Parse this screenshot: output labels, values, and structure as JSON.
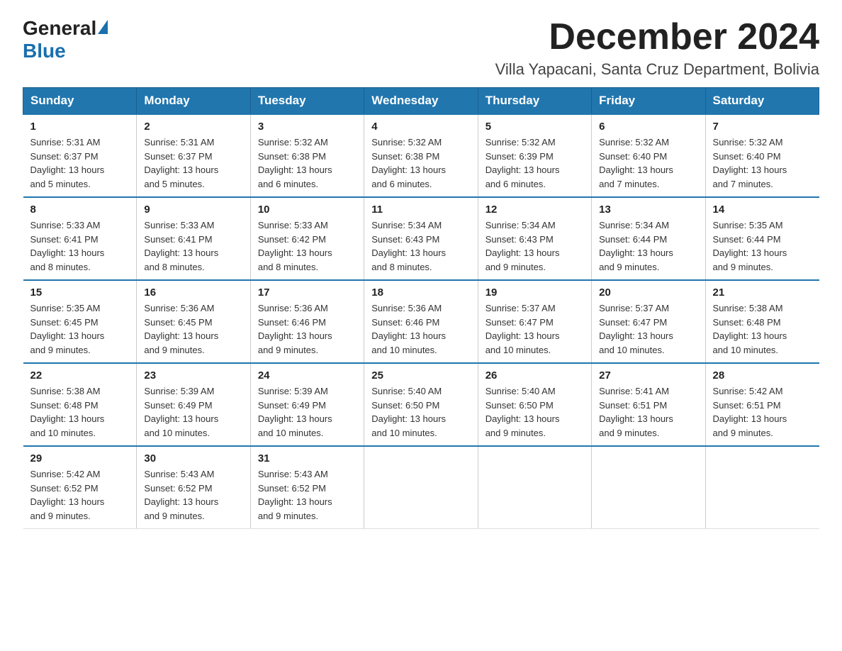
{
  "logo": {
    "general": "General",
    "blue": "Blue"
  },
  "title": "December 2024",
  "subtitle": "Villa Yapacani, Santa Cruz Department, Bolivia",
  "weekdays": [
    "Sunday",
    "Monday",
    "Tuesday",
    "Wednesday",
    "Thursday",
    "Friday",
    "Saturday"
  ],
  "weeks": [
    [
      {
        "day": "1",
        "sunrise": "5:31 AM",
        "sunset": "6:37 PM",
        "daylight": "13 hours and 5 minutes."
      },
      {
        "day": "2",
        "sunrise": "5:31 AM",
        "sunset": "6:37 PM",
        "daylight": "13 hours and 5 minutes."
      },
      {
        "day": "3",
        "sunrise": "5:32 AM",
        "sunset": "6:38 PM",
        "daylight": "13 hours and 6 minutes."
      },
      {
        "day": "4",
        "sunrise": "5:32 AM",
        "sunset": "6:38 PM",
        "daylight": "13 hours and 6 minutes."
      },
      {
        "day": "5",
        "sunrise": "5:32 AM",
        "sunset": "6:39 PM",
        "daylight": "13 hours and 6 minutes."
      },
      {
        "day": "6",
        "sunrise": "5:32 AM",
        "sunset": "6:40 PM",
        "daylight": "13 hours and 7 minutes."
      },
      {
        "day": "7",
        "sunrise": "5:32 AM",
        "sunset": "6:40 PM",
        "daylight": "13 hours and 7 minutes."
      }
    ],
    [
      {
        "day": "8",
        "sunrise": "5:33 AM",
        "sunset": "6:41 PM",
        "daylight": "13 hours and 8 minutes."
      },
      {
        "day": "9",
        "sunrise": "5:33 AM",
        "sunset": "6:41 PM",
        "daylight": "13 hours and 8 minutes."
      },
      {
        "day": "10",
        "sunrise": "5:33 AM",
        "sunset": "6:42 PM",
        "daylight": "13 hours and 8 minutes."
      },
      {
        "day": "11",
        "sunrise": "5:34 AM",
        "sunset": "6:43 PM",
        "daylight": "13 hours and 8 minutes."
      },
      {
        "day": "12",
        "sunrise": "5:34 AM",
        "sunset": "6:43 PM",
        "daylight": "13 hours and 9 minutes."
      },
      {
        "day": "13",
        "sunrise": "5:34 AM",
        "sunset": "6:44 PM",
        "daylight": "13 hours and 9 minutes."
      },
      {
        "day": "14",
        "sunrise": "5:35 AM",
        "sunset": "6:44 PM",
        "daylight": "13 hours and 9 minutes."
      }
    ],
    [
      {
        "day": "15",
        "sunrise": "5:35 AM",
        "sunset": "6:45 PM",
        "daylight": "13 hours and 9 minutes."
      },
      {
        "day": "16",
        "sunrise": "5:36 AM",
        "sunset": "6:45 PM",
        "daylight": "13 hours and 9 minutes."
      },
      {
        "day": "17",
        "sunrise": "5:36 AM",
        "sunset": "6:46 PM",
        "daylight": "13 hours and 9 minutes."
      },
      {
        "day": "18",
        "sunrise": "5:36 AM",
        "sunset": "6:46 PM",
        "daylight": "13 hours and 10 minutes."
      },
      {
        "day": "19",
        "sunrise": "5:37 AM",
        "sunset": "6:47 PM",
        "daylight": "13 hours and 10 minutes."
      },
      {
        "day": "20",
        "sunrise": "5:37 AM",
        "sunset": "6:47 PM",
        "daylight": "13 hours and 10 minutes."
      },
      {
        "day": "21",
        "sunrise": "5:38 AM",
        "sunset": "6:48 PM",
        "daylight": "13 hours and 10 minutes."
      }
    ],
    [
      {
        "day": "22",
        "sunrise": "5:38 AM",
        "sunset": "6:48 PM",
        "daylight": "13 hours and 10 minutes."
      },
      {
        "day": "23",
        "sunrise": "5:39 AM",
        "sunset": "6:49 PM",
        "daylight": "13 hours and 10 minutes."
      },
      {
        "day": "24",
        "sunrise": "5:39 AM",
        "sunset": "6:49 PM",
        "daylight": "13 hours and 10 minutes."
      },
      {
        "day": "25",
        "sunrise": "5:40 AM",
        "sunset": "6:50 PM",
        "daylight": "13 hours and 10 minutes."
      },
      {
        "day": "26",
        "sunrise": "5:40 AM",
        "sunset": "6:50 PM",
        "daylight": "13 hours and 9 minutes."
      },
      {
        "day": "27",
        "sunrise": "5:41 AM",
        "sunset": "6:51 PM",
        "daylight": "13 hours and 9 minutes."
      },
      {
        "day": "28",
        "sunrise": "5:42 AM",
        "sunset": "6:51 PM",
        "daylight": "13 hours and 9 minutes."
      }
    ],
    [
      {
        "day": "29",
        "sunrise": "5:42 AM",
        "sunset": "6:52 PM",
        "daylight": "13 hours and 9 minutes."
      },
      {
        "day": "30",
        "sunrise": "5:43 AM",
        "sunset": "6:52 PM",
        "daylight": "13 hours and 9 minutes."
      },
      {
        "day": "31",
        "sunrise": "5:43 AM",
        "sunset": "6:52 PM",
        "daylight": "13 hours and 9 minutes."
      },
      null,
      null,
      null,
      null
    ]
  ],
  "labels": {
    "sunrise": "Sunrise:",
    "sunset": "Sunset:",
    "daylight": "Daylight:"
  }
}
